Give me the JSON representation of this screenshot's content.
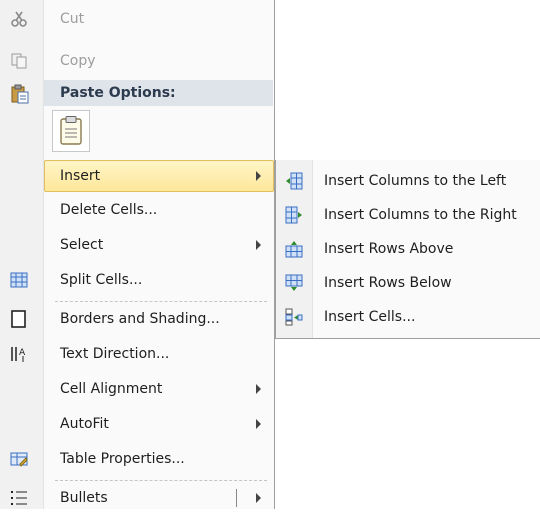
{
  "menu": {
    "cut": "Cut",
    "copy": "Copy",
    "paste_options": "Paste Options:",
    "insert": "Insert",
    "delete_cells": "Delete Cells...",
    "select": "Select",
    "split_cells": "Split Cells...",
    "borders": "Borders and Shading...",
    "text_direction": "Text Direction...",
    "cell_alignment": "Cell Alignment",
    "autofit": "AutoFit",
    "table_properties": "Table Properties...",
    "bullets": "Bullets"
  },
  "submenu": {
    "cols_left": "Insert Columns to the Left",
    "cols_right": "Insert Columns to the Right",
    "rows_above": "Insert Rows Above",
    "rows_below": "Insert Rows Below",
    "insert_cells": "Insert Cells..."
  },
  "colors": {
    "highlight": "#fde79a",
    "accent_blue": "#3a6fc4"
  }
}
